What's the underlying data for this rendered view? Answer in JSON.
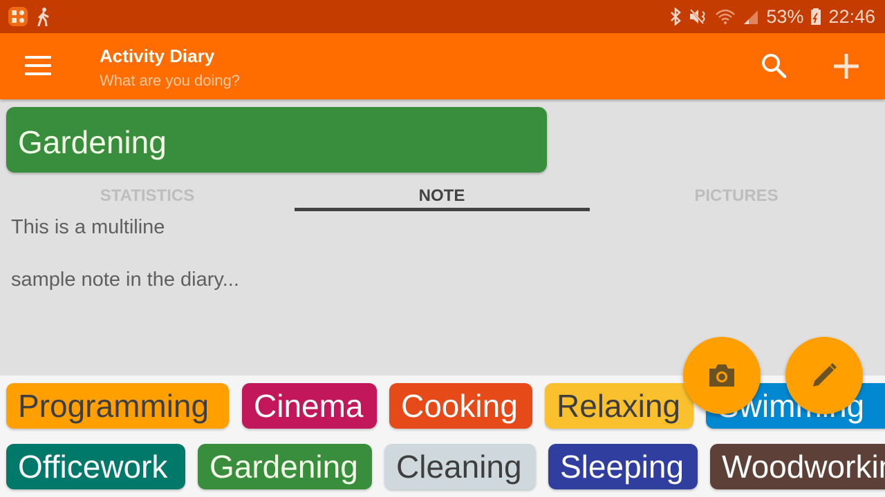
{
  "status_bar": {
    "battery_percent": "53%",
    "time": "22:46",
    "icons": [
      "app-notification-icon",
      "walking-icon",
      "bluetooth-icon",
      "mute-icon",
      "wifi-icon",
      "signal-icon",
      "battery-charging-icon"
    ]
  },
  "app_bar": {
    "title": "Activity Diary",
    "subtitle": "What are you doing?",
    "actions": [
      "menu-icon",
      "search-icon",
      "add-icon"
    ]
  },
  "current_activity": {
    "name": "Gardening",
    "color": "#388e3c"
  },
  "tabs": [
    {
      "label": "STATISTICS",
      "active": false
    },
    {
      "label": "NOTE",
      "active": true
    },
    {
      "label": "PICTURES",
      "active": false
    }
  ],
  "note": {
    "text": "This is a multiline\n\nsample note in the diary..."
  },
  "fabs": [
    {
      "name": "camera",
      "icon": "camera-icon",
      "color": "#ffa000"
    },
    {
      "name": "edit",
      "icon": "pencil-icon",
      "color": "#ffa000"
    }
  ],
  "activities": [
    {
      "label": "Programming",
      "color": "#ffa000",
      "text_color": "#3e3e3e"
    },
    {
      "label": "Cinema",
      "color": "#c2185b",
      "text_color": "#ffffff"
    },
    {
      "label": "Cooking",
      "color": "#e64a19",
      "text_color": "#ffffff"
    },
    {
      "label": "Relaxing",
      "color": "#fbc02d",
      "text_color": "#3e3e3e"
    },
    {
      "label": "Swimming",
      "color": "#0288d1",
      "text_color": "#ffffff"
    },
    {
      "label": "Officework",
      "color": "#00796b",
      "text_color": "#ffffff"
    },
    {
      "label": "Gardening",
      "color": "#388e3c",
      "text_color": "#f3fde8"
    },
    {
      "label": "Cleaning",
      "color": "#cfd8dc",
      "text_color": "#3e3e3e"
    },
    {
      "label": "Sleeping",
      "color": "#303f9f",
      "text_color": "#ffffff"
    },
    {
      "label": "Woodworking",
      "color": "#5d4037",
      "text_color": "#ffffff"
    }
  ]
}
